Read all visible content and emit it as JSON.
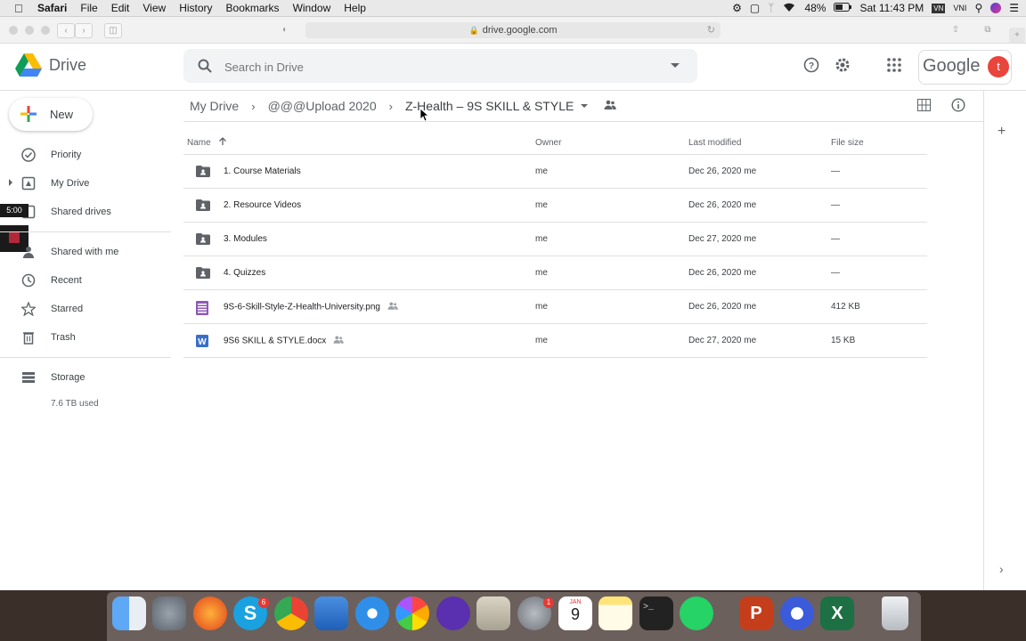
{
  "menubar": {
    "app": "Safari",
    "items": [
      "File",
      "Edit",
      "View",
      "History",
      "Bookmarks",
      "Window",
      "Help"
    ],
    "battery": "48%",
    "clock": "Sat 11:43 PM",
    "input_source": "VNI"
  },
  "browser": {
    "url": "drive.google.com"
  },
  "header": {
    "product": "Drive",
    "search_placeholder": "Search in Drive",
    "account_brand": "Google",
    "avatar_letter": "t"
  },
  "sidebar": {
    "new_label": "New",
    "items": [
      {
        "label": "Priority",
        "icon": "priority-icon"
      },
      {
        "label": "My Drive",
        "icon": "my-drive-icon"
      },
      {
        "label": "Shared drives",
        "icon": "shared-drives-icon"
      },
      {
        "label": "Shared with me",
        "icon": "shared-with-me-icon"
      },
      {
        "label": "Recent",
        "icon": "clock-icon"
      },
      {
        "label": "Starred",
        "icon": "star-icon"
      },
      {
        "label": "Trash",
        "icon": "trash-icon"
      }
    ],
    "storage_label": "Storage",
    "storage_used": "7.6 TB used",
    "overlay_timer": "5:00"
  },
  "breadcrumb": {
    "items": [
      "My Drive",
      "@@@Upload 2020"
    ],
    "current": "Z-Health – 9S SKILL & STYLE"
  },
  "table": {
    "columns": {
      "name": "Name",
      "owner": "Owner",
      "modified": "Last modified",
      "size": "File size"
    },
    "rows": [
      {
        "name": "1. Course Materials",
        "type": "shared-folder",
        "owner": "me",
        "modified": "Dec 26, 2020",
        "modified_by": "me",
        "size": "—",
        "shared": false
      },
      {
        "name": "2. Resource Videos",
        "type": "shared-folder",
        "owner": "me",
        "modified": "Dec 26, 2020",
        "modified_by": "me",
        "size": "—",
        "shared": false
      },
      {
        "name": "3. Modules",
        "type": "shared-folder",
        "owner": "me",
        "modified": "Dec 27, 2020",
        "modified_by": "me",
        "size": "—",
        "shared": false
      },
      {
        "name": "4. Quizzes",
        "type": "shared-folder",
        "owner": "me",
        "modified": "Dec 26, 2020",
        "modified_by": "me",
        "size": "—",
        "shared": false
      },
      {
        "name": "9S-6-Skill-Style-Z-Health-University.png",
        "type": "image",
        "owner": "me",
        "modified": "Dec 26, 2020",
        "modified_by": "me",
        "size": "412 KB",
        "shared": true
      },
      {
        "name": "9S6 SKILL & STYLE.docx",
        "type": "word-doc",
        "owner": "me",
        "modified": "Dec 27, 2020",
        "modified_by": "me",
        "size": "15 KB",
        "shared": true
      }
    ]
  },
  "dock": {
    "skype_badge": "6",
    "settings_badge": "1",
    "calendar_month": "JAN",
    "calendar_day": "9"
  },
  "colors": {
    "accent_blue": "#1a73e8",
    "text_primary": "#202124",
    "text_secondary": "#5f6368",
    "avatar": "#e8453c"
  }
}
